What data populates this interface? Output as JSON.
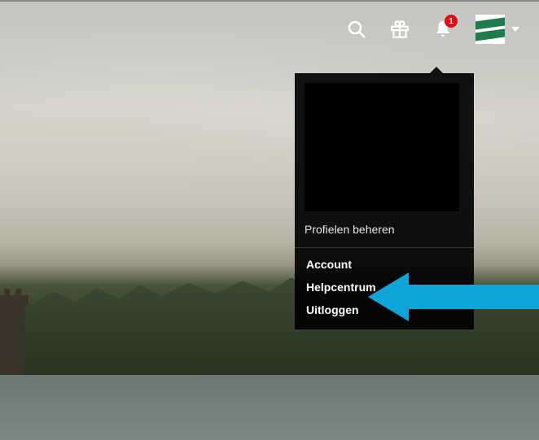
{
  "topbar": {
    "notifications_count": "1"
  },
  "dropdown": {
    "manage_profiles": "Profielen beheren",
    "menu": {
      "account": "Account",
      "help": "Helpcentrum",
      "logout": "Uitloggen"
    }
  },
  "annotation": {
    "arrow_target": "account"
  }
}
